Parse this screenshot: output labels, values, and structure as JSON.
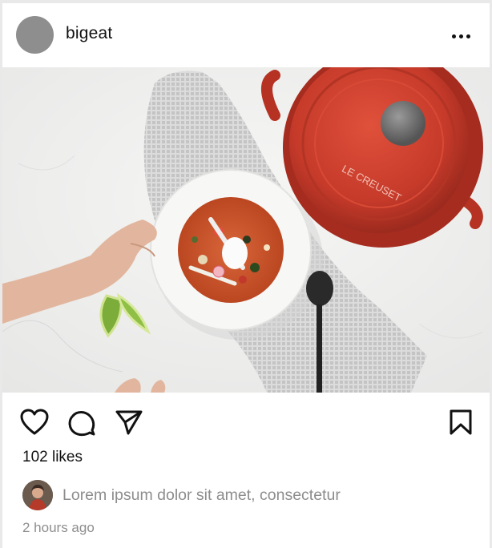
{
  "post": {
    "username": "bigeat",
    "more_icon": "more-horizontal-icon",
    "photo_description_icons": [
      "stew-bowl",
      "dutch-oven",
      "lime-wedges",
      "spoon",
      "dish-towel"
    ],
    "pot_brand_text": "LE CREUSET",
    "likes_text": "102 likes",
    "caption": "Lorem ipsum dolor sit amet, consectetur",
    "timestamp": "2 hours ago"
  },
  "actions": {
    "like_icon": "heart-icon",
    "comment_icon": "comment-icon",
    "share_icon": "send-icon",
    "save_icon": "bookmark-icon"
  },
  "colors": {
    "pot_red": "#c63a2a",
    "stew_orange": "#c9502c",
    "lime_green": "#7cac3a",
    "text_primary": "#111111",
    "text_muted": "#8e8e8e"
  }
}
